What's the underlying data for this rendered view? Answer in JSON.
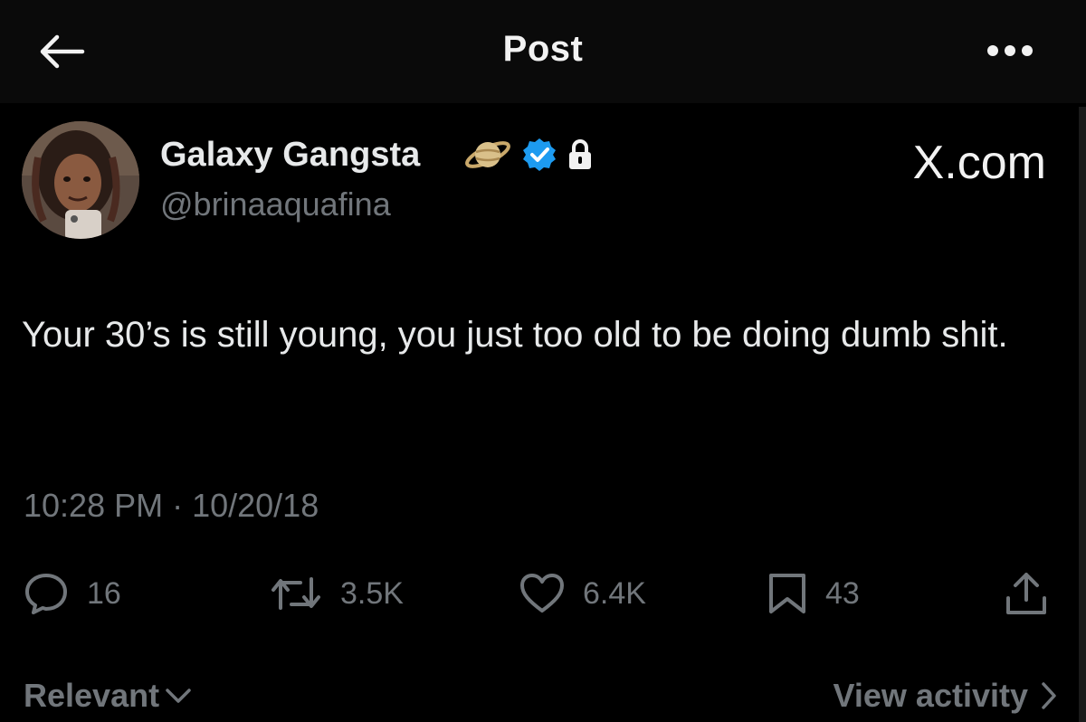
{
  "header": {
    "title": "Post",
    "back_icon": "arrow-left-icon",
    "more_icon": "more-horizontal-icon"
  },
  "author": {
    "name": "Galaxy Gangsta",
    "handle": "@brinaaquafina",
    "badges": [
      "saturn-emoji",
      "verified-badge",
      "lock-icon"
    ]
  },
  "watermark": "X.com",
  "post": {
    "text": "Your 30’s is still young, you just too old to be doing dumb shit.",
    "timestamp": "10:28 PM · 10/20/18"
  },
  "actions": {
    "replies": "16",
    "reposts": "3.5K",
    "likes": "6.4K",
    "bookmarks": "43"
  },
  "footer": {
    "sort_label": "Relevant",
    "view_activity": "View activity"
  },
  "colors": {
    "background": "#000000",
    "text_primary": "#e7e9ea",
    "text_secondary": "#71767b",
    "verified_blue": "#1d9bf0"
  }
}
